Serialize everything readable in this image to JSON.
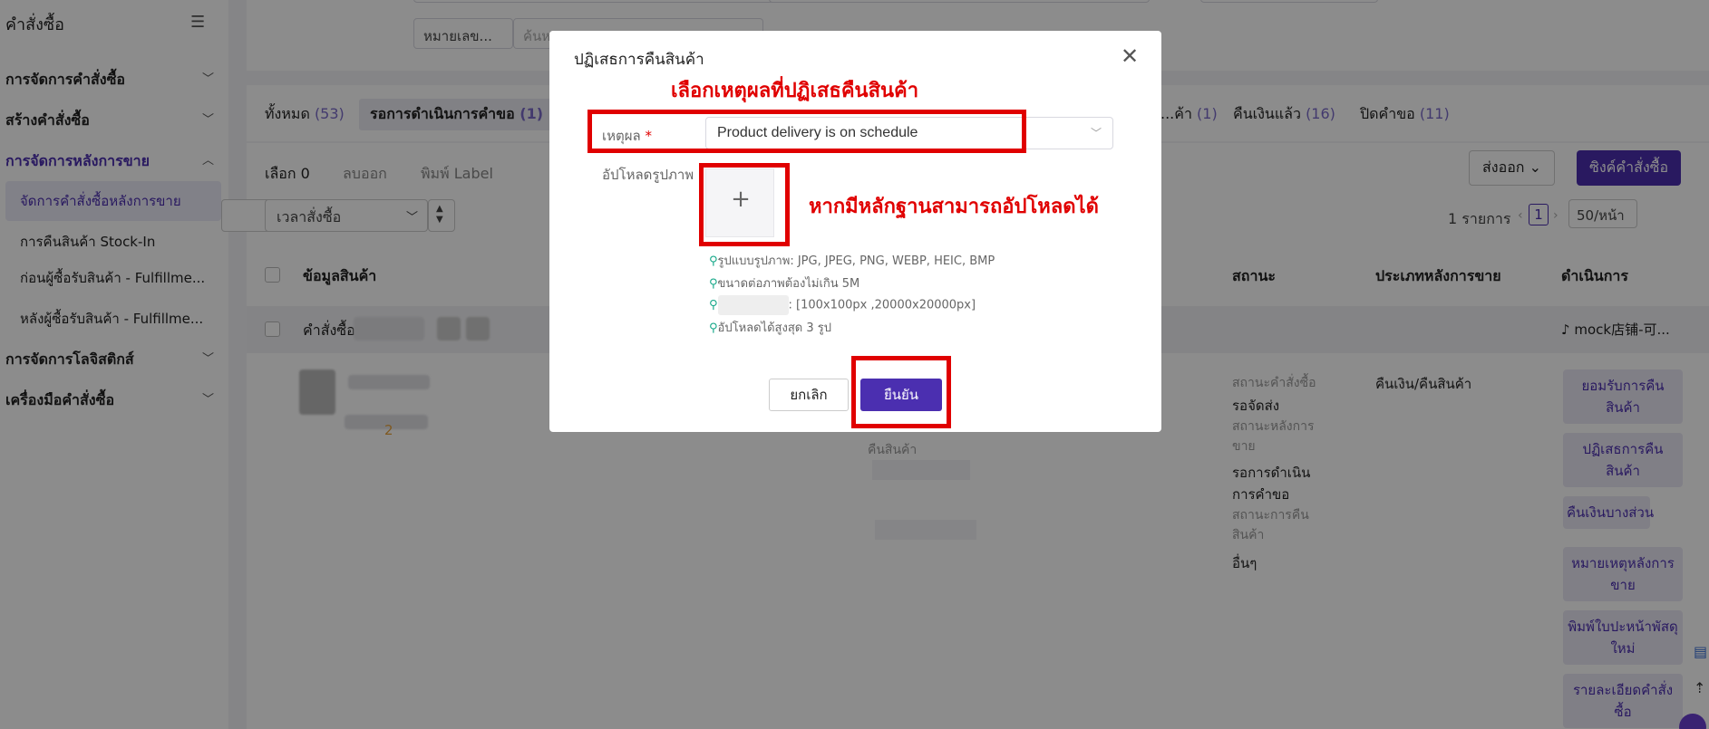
{
  "sidebar": {
    "title": "คำสั่งซื้อ",
    "groups": [
      {
        "label": "การจัดการคำสั่งซื้อ"
      },
      {
        "label": "สร้างคำสั่งซื้อ"
      },
      {
        "label": "การจัดการหลังการขาย"
      },
      {
        "label": "การจัดการโลจิสติกส์"
      },
      {
        "label": "เครื่องมือคำสั่งซื้อ"
      }
    ],
    "subitems": [
      {
        "label": "จัดการคำสั่งซื้อหลังการขาย"
      },
      {
        "label": "การคืนสินค้า Stock-In"
      },
      {
        "label": "ก่อนผู้ซื้อรับสินค้า - Fulfillme..."
      },
      {
        "label": "หลังผู้ซื้อรับสินค้า - Fulfillme..."
      }
    ]
  },
  "filters": {
    "search_type": "หมายเลข...",
    "search_placeholder": "ค้นห"
  },
  "tabs": [
    {
      "label": "ทั้งหมด",
      "count": "(53)"
    },
    {
      "label": "รอการดำเนินการคำขอ",
      "count": "(1)"
    },
    {
      "label": "...ค้า",
      "count": "(1)"
    },
    {
      "label": "คืนเงินแล้ว",
      "count": "(16)"
    },
    {
      "label": "ปิดคำขอ",
      "count": "(11)"
    }
  ],
  "toolbar": {
    "selected": "เลือก 0",
    "delete": "ลบออก",
    "print_label": "พิมพ์ Label",
    "export": "ส่งออก",
    "sync": "ซิงค์คำสั่งซื้อ",
    "time_select": "เวลาสั่งซื้อ",
    "total": "1 รายการ",
    "page": "1",
    "page_size": "50/หน้า"
  },
  "table": {
    "headers": {
      "product": "ข้อมูลสินค้า",
      "status": "สถานะ",
      "aftersale_type": "ประเภทหลังการขาย",
      "action": "ดำเนินการ"
    },
    "order_label": "คำสั่งซื้อ",
    "store_name": "mock店铺-可...",
    "qty": "2",
    "status": {
      "order_status_label": "สถานะคำสั่งซื้อ",
      "order_status": "รอจัดส่ง",
      "aftersale_status_label": "สถานะหลังการขาย",
      "aftersale_status": "รอการดำเนินการคำขอ",
      "return_status_label": "สถานะการคืนสินค้า",
      "return_status": "อื่นๆ",
      "return_label_left": "คืนสินค้า"
    },
    "aftersale_type": "คืนเงิน/คืนสินค้า",
    "actions": [
      "ยอมรับการคืนสินค้า",
      "ปฏิเสธการคืนสินค้า",
      "คืนเงินบางส่วน",
      "หมายเหตุหลังการขาย",
      "พิมพ์ใบปะหน้าพัสดุใหม่",
      "รายละเอียดคำสั่งซื้อ"
    ]
  },
  "modal": {
    "title": "ปฏิเสธการคืนสินค้า",
    "annotation_reason": "เลือกเหตุผลที่ปฏิเสธคืนสินค้า",
    "annotation_upload": "หากมีหลักฐานสามารถอัปโหลดได้",
    "reason_label": "เหตุผล",
    "reason_required": "*",
    "reason_value": "Product delivery is on schedule",
    "upload_label": "อัปโหลดรูปภาพ",
    "hints": [
      "รูปแบบรูปภาพ:  JPG, JPEG, PNG, WEBP, HEIC, BMP",
      "ขนาดต่อภาพต้องไม่เกิน 5M",
      ":   [100x100px ,20000x20000px]",
      "อัปโหลดได้สูงสุด 3 รูป"
    ],
    "cancel": "ยกเลิก",
    "confirm": "ยืนยัน",
    "accent_color": "#4b2fb0",
    "annotation_color": "#e00000"
  }
}
